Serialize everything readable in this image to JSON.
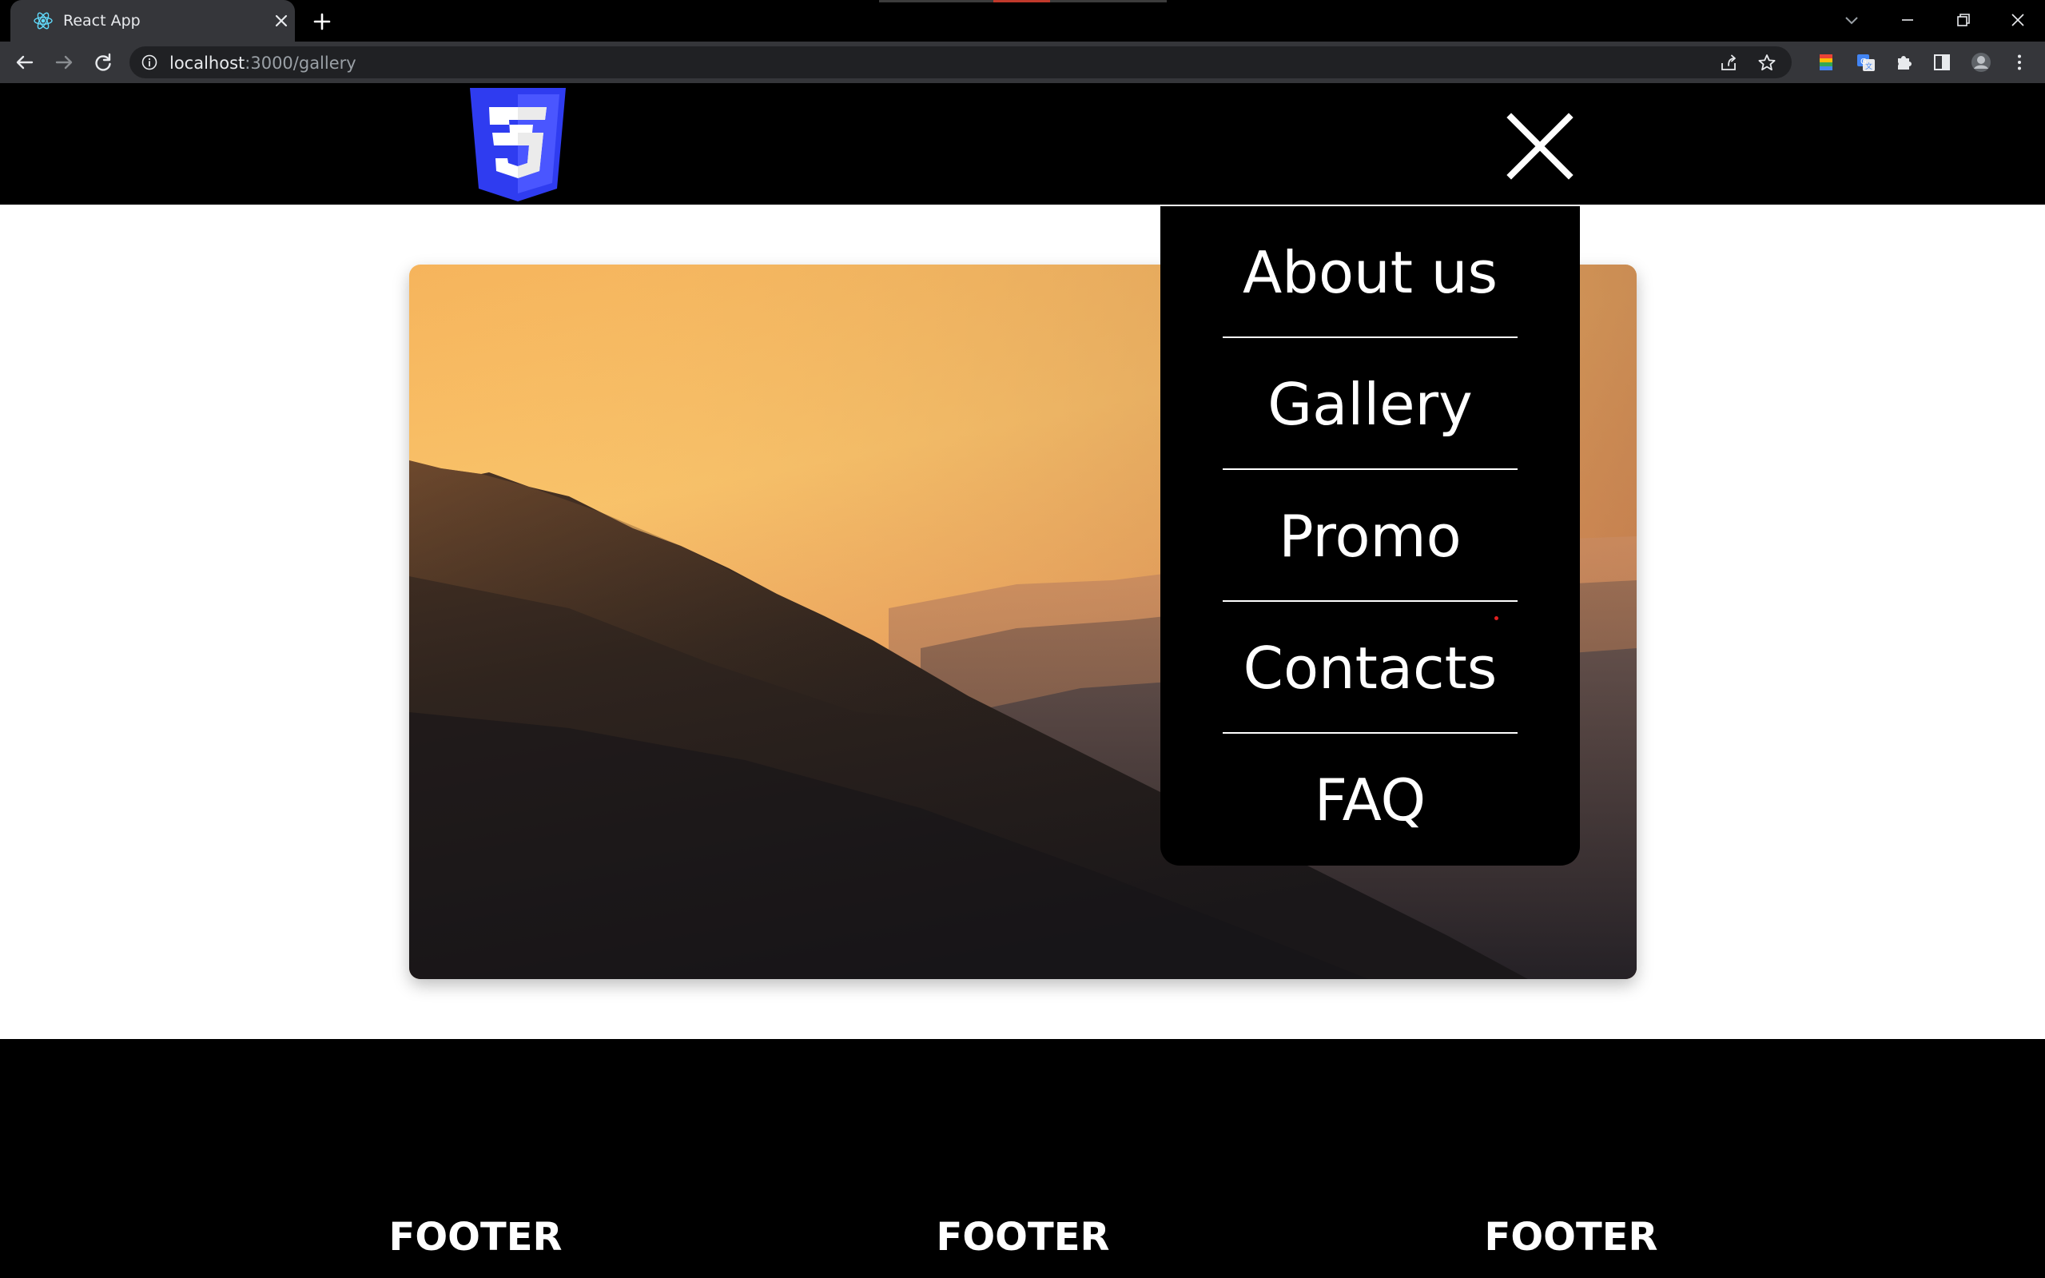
{
  "browser": {
    "tab_title": "React App",
    "url_host": "localhost",
    "url_path": ":3000/gallery"
  },
  "icons": {
    "favicon": "react-logo-icon",
    "logo": "css3-logo-icon",
    "close_menu": "close-icon"
  },
  "menu": {
    "items": [
      {
        "label": "About us"
      },
      {
        "label": "Gallery"
      },
      {
        "label": "Promo"
      },
      {
        "label": "Contacts"
      },
      {
        "label": "FAQ"
      }
    ]
  },
  "footer": {
    "columns": [
      "FOOTER",
      "FOOTER",
      "FOOTER"
    ]
  },
  "colors": {
    "header_bg": "#000000",
    "menu_bg": "#000000",
    "footer_bg": "#000000",
    "logo_blue": "#2f3cf0",
    "sky_top": "#f9c36a",
    "mountain": "#2b221c"
  }
}
